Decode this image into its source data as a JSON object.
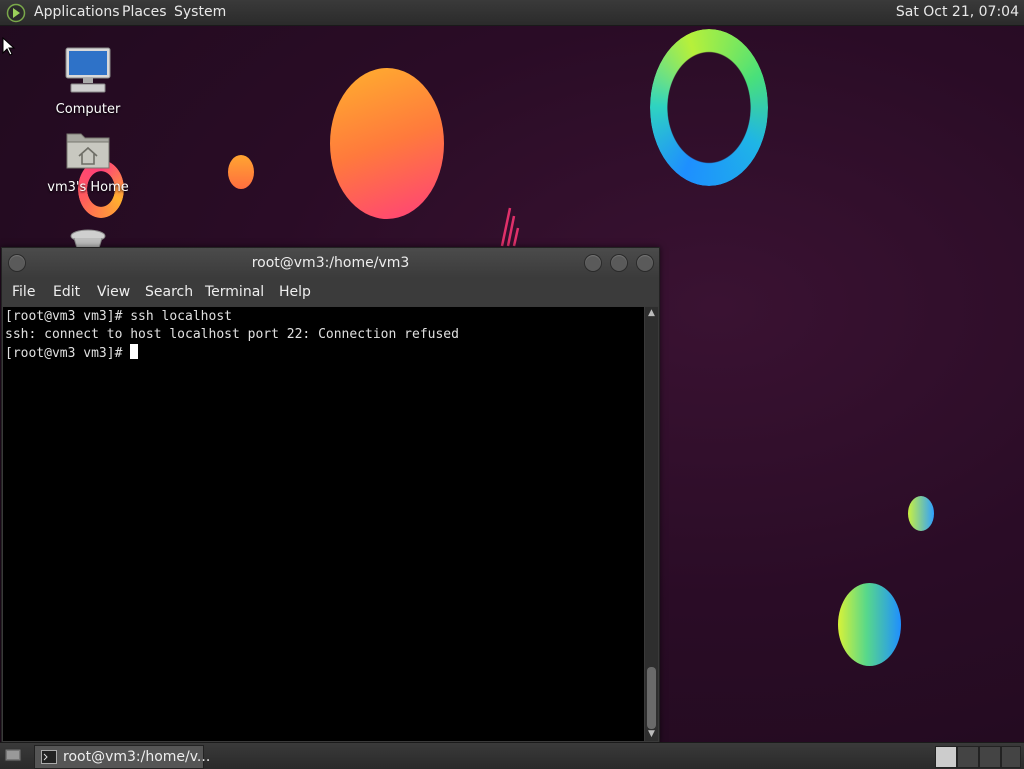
{
  "top_panel": {
    "menus": [
      "Applications",
      "Places",
      "System"
    ],
    "clock": "Sat Oct 21, 07:04"
  },
  "desktop": {
    "icons": [
      {
        "label": "Computer"
      },
      {
        "label": "vm3's Home"
      }
    ]
  },
  "terminal": {
    "title": "root@vm3:/home/vm3",
    "menu": [
      "File",
      "Edit",
      "View",
      "Search",
      "Terminal",
      "Help"
    ],
    "lines": [
      "[root@vm3 vm3]# ssh localhost",
      "ssh: connect to host localhost port 22: Connection refused",
      "[root@vm3 vm3]# "
    ]
  },
  "bottom_panel": {
    "task_label": "root@vm3:/home/v..."
  }
}
